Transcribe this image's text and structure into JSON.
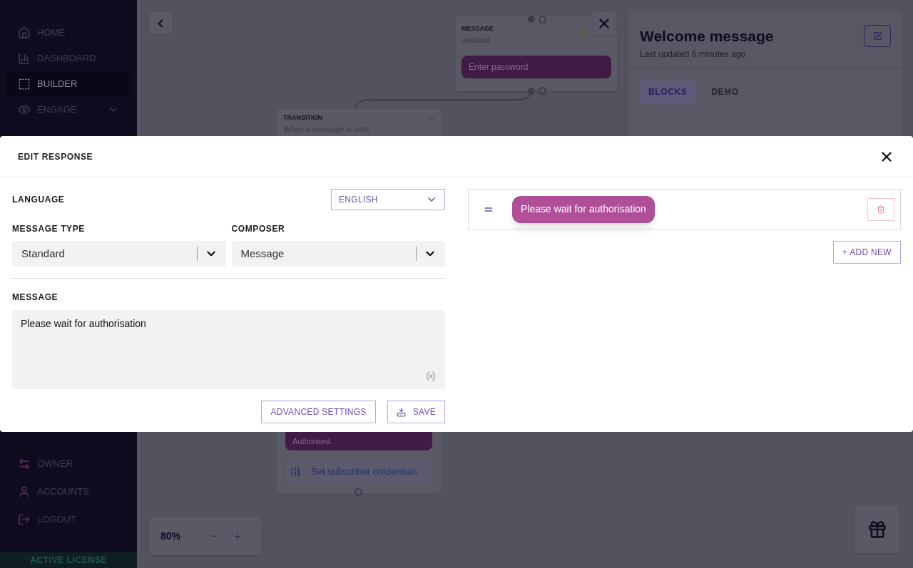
{
  "sidebar": {
    "items": [
      {
        "label": "HOME",
        "selected": false,
        "expandable": false
      },
      {
        "label": "DASHBOARD",
        "selected": false,
        "expandable": false
      },
      {
        "label": "BUILDER",
        "selected": true,
        "expandable": false
      },
      {
        "label": "ENGAGE",
        "selected": false,
        "expandable": true
      }
    ],
    "bottom_items": [
      {
        "label": "OWNER"
      },
      {
        "label": "ACCOUNTS"
      },
      {
        "label": "LOGOUT"
      }
    ],
    "license": "ACTIVE LICENSE"
  },
  "canvas": {
    "message_node": {
      "type": "MESSAGE",
      "text": "awdwad",
      "hidden": true,
      "input": "Enter password"
    },
    "transition_node": {
      "type": "TRANSITION",
      "text": "When a message is sent",
      "menu": "..."
    },
    "lower_node": {
      "bubble": "Authorised.",
      "action": "Set subscriber credentials"
    },
    "zoom": {
      "value": "80%",
      "minus": "−",
      "plus": "+"
    }
  },
  "panel": {
    "title": "Welcome message",
    "subtitle": "Last updated 6 minutes ago",
    "tabs": [
      {
        "label": "BLOCKS",
        "selected": true
      },
      {
        "label": "DEMO",
        "selected": false
      }
    ]
  },
  "modal": {
    "title": "EDIT RESPONSE",
    "language": {
      "label": "LANGUAGE",
      "value": "ENGLISH"
    },
    "message_type": {
      "label": "MESSAGE TYPE",
      "value": "Standard"
    },
    "composer": {
      "label": "COMPOSER",
      "value": "Message"
    },
    "message": {
      "label": "MESSAGE",
      "value": "Please wait for authorisation"
    },
    "buttons": {
      "advanced": "ADVANCED SETTINGS",
      "save": "SAVE"
    },
    "responses": [
      {
        "text": "Please wait for authorisation"
      }
    ],
    "add_new": "+ ADD NEW"
  }
}
